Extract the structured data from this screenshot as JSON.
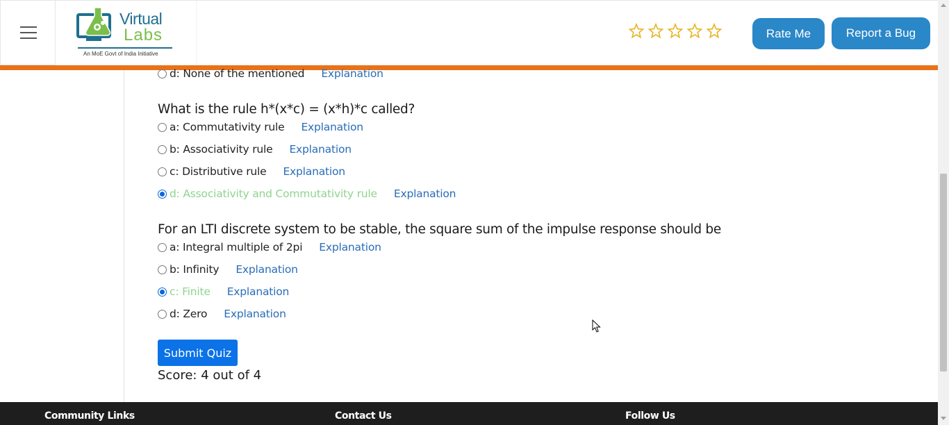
{
  "header": {
    "logo": {
      "word1": "Virtual",
      "word2": "Labs",
      "tagline": "An MoE Govt of India Initiative"
    },
    "rating": {
      "stars_total": 5,
      "stars_filled": 0
    },
    "rate_button": "Rate Me",
    "bug_button": "Report a Bug"
  },
  "quiz": {
    "partial_option": {
      "label": "d: None of the mentioned",
      "explanation": "Explanation",
      "checked": false,
      "correct": false
    },
    "questions": [
      {
        "text": "What is the rule h*(x*c) = (x*h)*c called?",
        "options": [
          {
            "label": "a: Commutativity rule",
            "explanation": "Explanation",
            "checked": false,
            "correct": false
          },
          {
            "label": "b: Associativity rule",
            "explanation": "Explanation",
            "checked": false,
            "correct": false
          },
          {
            "label": "c: Distributive rule",
            "explanation": "Explanation",
            "checked": false,
            "correct": false
          },
          {
            "label": "d: Associativity and Commutativity rule",
            "explanation": "Explanation",
            "checked": true,
            "correct": true
          }
        ]
      },
      {
        "text": "For an LTI discrete system to be stable, the square sum of the impulse response should be",
        "options": [
          {
            "label": "a: Integral multiple of 2pi",
            "explanation": "Explanation",
            "checked": false,
            "correct": false
          },
          {
            "label": "b: Infinity",
            "explanation": "Explanation",
            "checked": false,
            "correct": false
          },
          {
            "label": "c: Finite",
            "explanation": "Explanation",
            "checked": true,
            "correct": true
          },
          {
            "label": "d: Zero",
            "explanation": "Explanation",
            "checked": false,
            "correct": false
          }
        ]
      }
    ],
    "submit_label": "Submit Quiz",
    "score_text": "Score: 4 out of 4"
  },
  "footer": {
    "community": "Community Links",
    "contact": "Contact Us",
    "follow": "Follow Us"
  },
  "colors": {
    "accent": "#2a87c8",
    "orange": "#e8711a",
    "correct": "#8fd48f",
    "link": "#2a6db8",
    "submit": "#0b72e7"
  }
}
